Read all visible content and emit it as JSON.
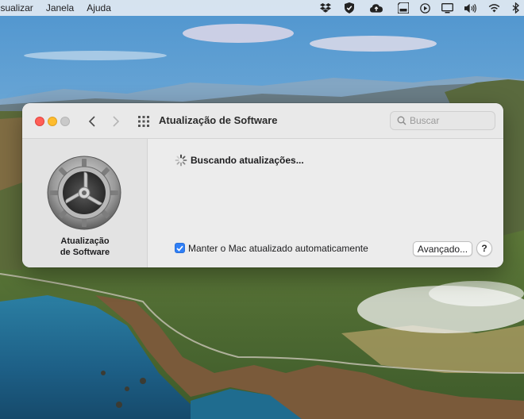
{
  "menubar": {
    "items": [
      "Visualizar",
      "Janela",
      "Ajuda"
    ],
    "status_icons": [
      "dropbox-icon",
      "shield-check-icon",
      "icloud-upload-icon",
      "sd-card-icon",
      "play-circle-icon",
      "display-icon",
      "volume-icon",
      "wifi-icon",
      "bluetooth-icon"
    ]
  },
  "window": {
    "title": "Atualização de Software",
    "search": {
      "placeholder": "Buscar",
      "value": ""
    },
    "sidebar": {
      "label_line1": "Atualização",
      "label_line2": "de Software"
    },
    "status_text": "Buscando atualizações...",
    "auto_update": {
      "label": "Manter o Mac atualizado automaticamente",
      "checked": true
    },
    "advanced_button": "Avançado...",
    "help_button": "?"
  },
  "colors": {
    "accent": "#2f7ff6",
    "traffic_close": "#ff5f57",
    "traffic_minimize": "#febc2e",
    "traffic_zoom_inactive": "#c9c9c9"
  }
}
